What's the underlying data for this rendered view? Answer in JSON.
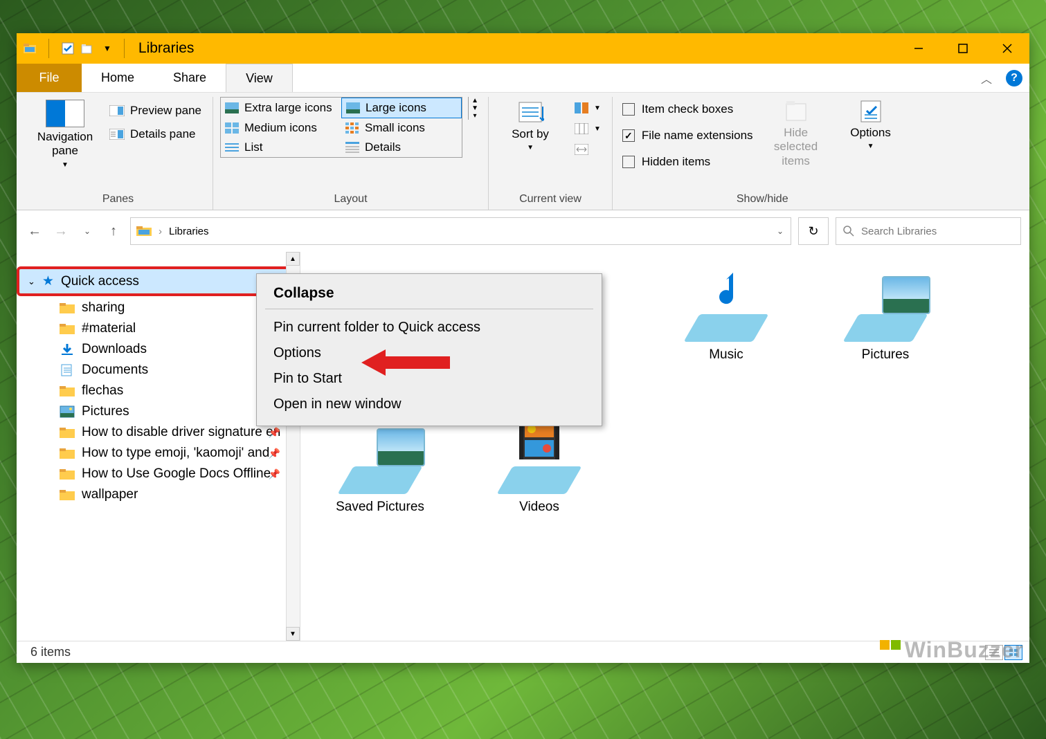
{
  "window": {
    "title": "Libraries"
  },
  "ribbon_tabs": {
    "file": "File",
    "home": "Home",
    "share": "Share",
    "view": "View"
  },
  "panes_group": {
    "label": "Panes",
    "nav_pane": "Navigation pane",
    "preview": "Preview pane",
    "details": "Details pane"
  },
  "layout_group": {
    "label": "Layout",
    "xl": "Extra large icons",
    "large": "Large icons",
    "medium": "Medium icons",
    "small": "Small icons",
    "list": "List",
    "details": "Details"
  },
  "current_view_group": {
    "label": "Current view",
    "sort_by": "Sort by"
  },
  "show_hide_group": {
    "label": "Show/hide",
    "item_check": "Item check boxes",
    "file_ext": "File name extensions",
    "hidden": "Hidden items",
    "hide_sel": "Hide selected items",
    "options": "Options"
  },
  "address_bar": {
    "path": "Libraries"
  },
  "search": {
    "placeholder": "Search Libraries"
  },
  "sidebar": {
    "quick_access": "Quick access",
    "items": [
      {
        "label": "sharing",
        "icon": "folder"
      },
      {
        "label": "#material",
        "icon": "folder"
      },
      {
        "label": "Downloads",
        "icon": "download"
      },
      {
        "label": "Documents",
        "icon": "document"
      },
      {
        "label": "flechas",
        "icon": "folder",
        "pinned": true
      },
      {
        "label": "Pictures",
        "icon": "pictures",
        "pinned": true
      },
      {
        "label": "How to disable driver signature en",
        "icon": "folder",
        "pinned": true
      },
      {
        "label": "How to type emoji, 'kaomoji' and",
        "icon": "folder",
        "pinned": true
      },
      {
        "label": "How to Use Google Docs Offline",
        "icon": "folder",
        "pinned": true
      },
      {
        "label": "wallpaper",
        "icon": "folder"
      }
    ]
  },
  "items": [
    {
      "label": "Music",
      "kind": "music"
    },
    {
      "label": "Pictures",
      "kind": "pictures"
    },
    {
      "label": "Saved Pictures",
      "kind": "pictures"
    },
    {
      "label": "Videos",
      "kind": "videos"
    }
  ],
  "context_menu": {
    "title": "Collapse",
    "items": [
      "Pin current folder to Quick access",
      "Options",
      "Pin to Start",
      "Open in new window"
    ]
  },
  "status": {
    "count_text": "6 items"
  },
  "watermark": "WinBuzzer"
}
